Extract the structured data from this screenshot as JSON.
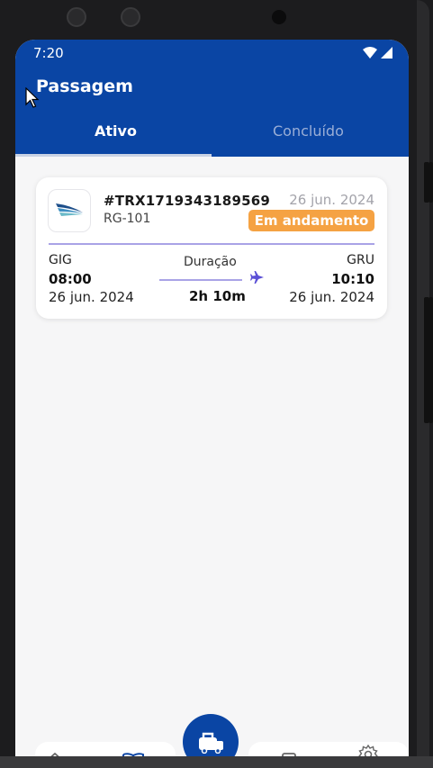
{
  "status_bar": {
    "time": "7:20"
  },
  "app": {
    "title": "Passagem"
  },
  "tabs": [
    {
      "label": "Ativo",
      "active": true
    },
    {
      "label": "Concluído",
      "active": false
    }
  ],
  "ticket": {
    "trx": "#TRX1719343189569",
    "flight": "RG-101",
    "date": "26 jun. 2024",
    "status": "Em andamento",
    "origin": {
      "code": "GIG",
      "time": "08:00",
      "date": "26 jun. 2024"
    },
    "duration_label": "Duração",
    "duration": "2h 10m",
    "destination": {
      "code": "GRU",
      "time": "10:10",
      "date": "26 jun. 2024"
    }
  },
  "nav": {
    "items": [
      {
        "icon": "home-icon"
      },
      {
        "icon": "book-icon"
      },
      {
        "icon": "luggage-icon"
      },
      {
        "icon": "list-icon"
      },
      {
        "icon": "gear-icon"
      }
    ]
  },
  "colors": {
    "brand": "#0a45a4",
    "badge": "#f5a243",
    "accent_line": "#a9a3e6",
    "plane": "#5b50d6"
  }
}
